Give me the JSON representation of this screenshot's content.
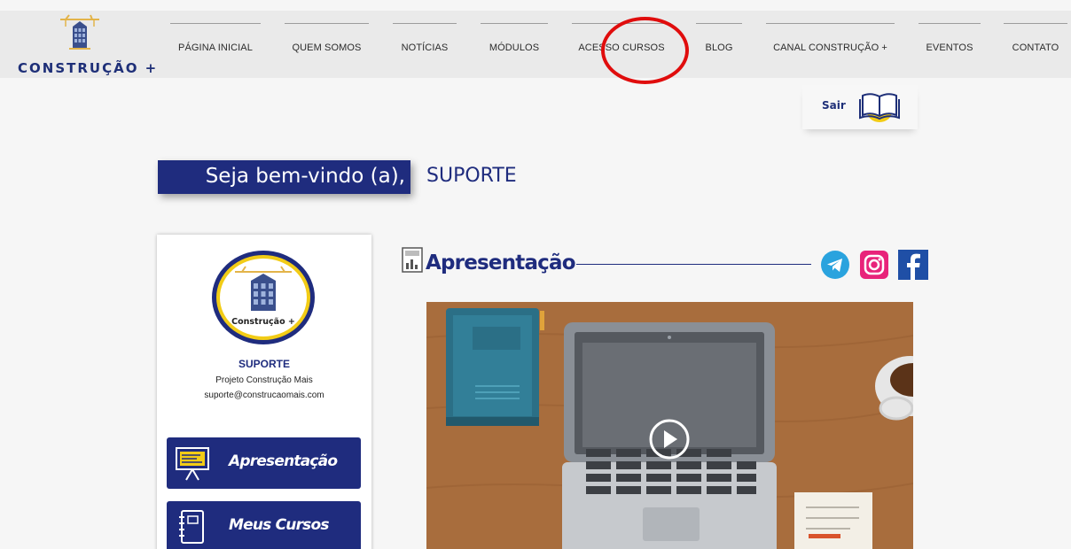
{
  "header": {
    "brand": "CONSTRUÇÃO +",
    "nav": [
      {
        "label": "PÁGINA INICIAL"
      },
      {
        "label": "QUEM SOMOS"
      },
      {
        "label": "NOTÍCIAS"
      },
      {
        "label": "MÓDULOS"
      },
      {
        "label": "ACESSO CURSOS"
      },
      {
        "label": "BLOG"
      },
      {
        "label": "CANAL CONSTRUÇÃO +"
      },
      {
        "label": "EVENTOS"
      },
      {
        "label": "CONTATO"
      }
    ]
  },
  "account": {
    "logout_label": "Sair",
    "icon": "open-book-icon"
  },
  "welcome": {
    "greeting": "Seja bem-vindo (a),",
    "name": "SUPORTE"
  },
  "profile": {
    "avatar_text": "Construção +",
    "name": "SUPORTE",
    "organization": "Projeto Construção Mais",
    "email": "suporte@construcaomais.com"
  },
  "sidebar": {
    "buttons": [
      {
        "label": "Apresentação",
        "icon": "presentation-board-icon"
      },
      {
        "label": "Meus Cursos",
        "icon": "notebook-icon"
      }
    ]
  },
  "main": {
    "section_title": "Apresentação",
    "social": [
      {
        "icon": "telegram-icon",
        "color": "#2aa3de"
      },
      {
        "icon": "instagram-icon",
        "color": "#e8237a"
      },
      {
        "icon": "facebook-icon",
        "color": "#1f4fa6"
      }
    ],
    "video": {
      "play_icon": "play-icon"
    }
  },
  "colors": {
    "brand_navy": "#1f2c7e",
    "highlight_red": "#e00d0d",
    "header_bg": "#eaeaea"
  }
}
